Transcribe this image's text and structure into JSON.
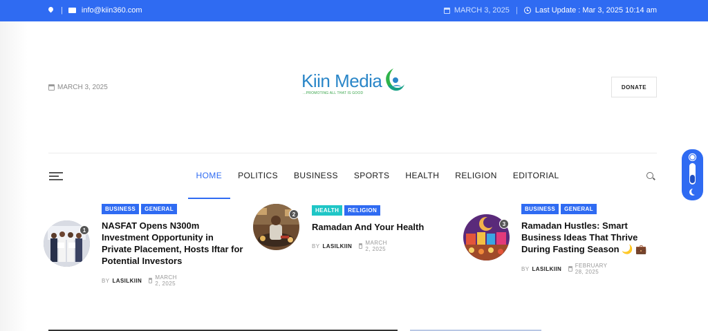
{
  "topbar": {
    "location_icon": "location-pin-icon",
    "email": "info@kiin360.com",
    "date": "MARCH 3, 2025",
    "last_update": "Last Update : Mar 3, 2025 10:14 am"
  },
  "header": {
    "date": "MARCH 3, 2025",
    "logo_text": "Kiin Media",
    "logo_tagline": "...PROMOTING ALL THAT IS GOOD",
    "donate_label": "DONATE"
  },
  "nav": {
    "items": [
      "HOME",
      "POLITICS",
      "BUSINESS",
      "SPORTS",
      "HEALTH",
      "RELIGION",
      "EDITORIAL"
    ],
    "active": "HOME"
  },
  "posts": [
    {
      "rank": "1",
      "categories": [
        "BUSINESS",
        "GENERAL"
      ],
      "title": "NASFAT Opens N300m Investment Opportunity in Private Placement, Hosts Iftar for Potential Investors",
      "by": "BY",
      "author": "LASILKIIN",
      "date": "MARCH 2, 2025"
    },
    {
      "rank": "2",
      "categories": [
        "HEALTH",
        "RELIGION"
      ],
      "title": "Ramadan And Your Health",
      "by": "BY",
      "author": "LASILKIIN",
      "date": "MARCH 2, 2025"
    },
    {
      "rank": "3",
      "categories": [
        "BUSINESS",
        "GENERAL"
      ],
      "title": "Ramadan Hustles: Smart Business Ideas That Thrive During Fasting Season 🌙 💼",
      "by": "BY",
      "author": "LASILKIIN",
      "date": "FEBRUARY 28, 2025"
    }
  ],
  "colors": {
    "accent": "#2f6bf2",
    "teal": "#1fc6c6"
  }
}
